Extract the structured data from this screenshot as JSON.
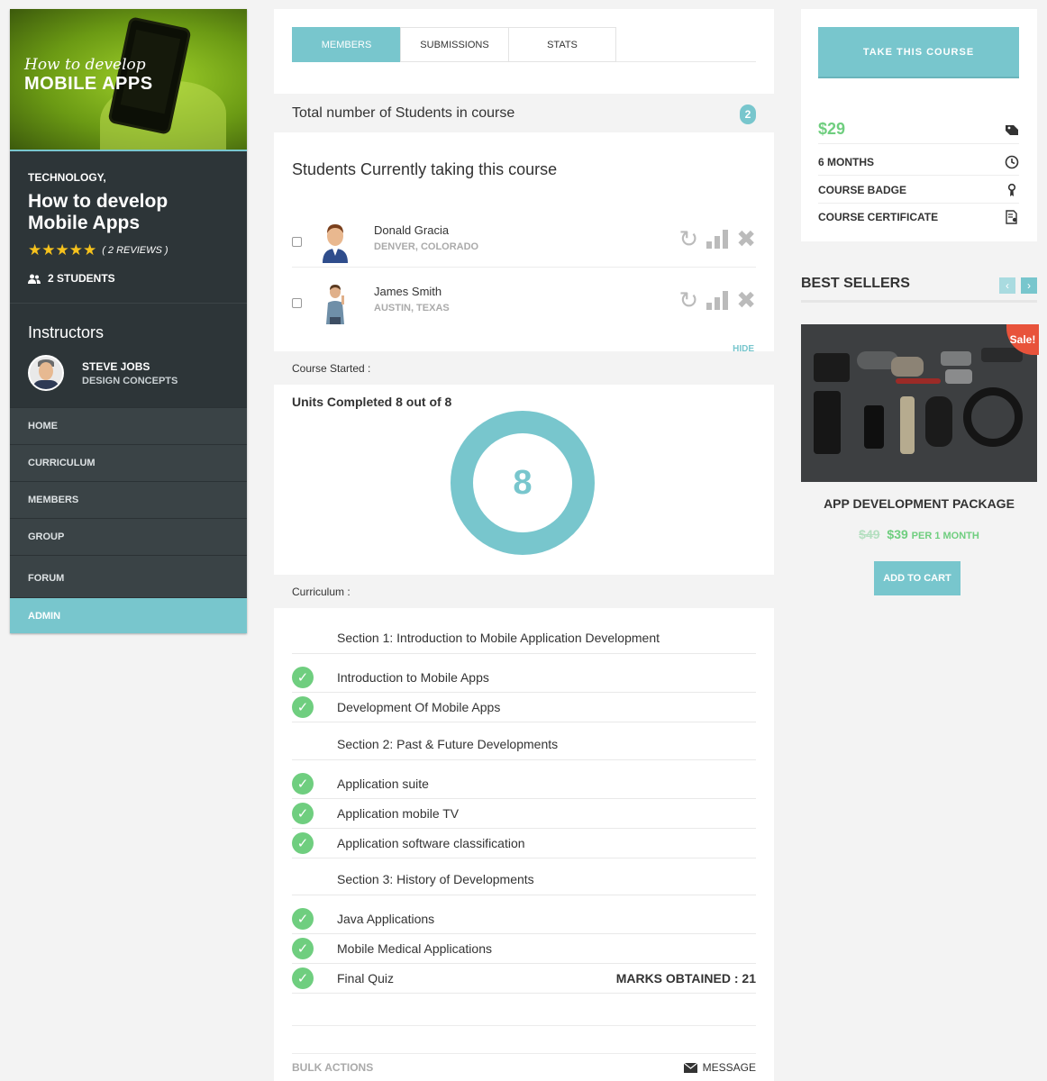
{
  "course": {
    "image_line1": "How to develop",
    "image_line2": "MOBILE APPS",
    "category": "TECHNOLOGY,",
    "title": "How to develop Mobile Apps",
    "stars": "★★★★★",
    "reviews": "( 2 REVIEWS )",
    "students": "2 STUDENTS"
  },
  "instructors": {
    "heading": "Instructors",
    "name": "STEVE JOBS",
    "role": "DESIGN CONCEPTS"
  },
  "nav": [
    "HOME",
    "CURRICULUM",
    "MEMBERS",
    "GROUP",
    "FORUM",
    "ADMIN"
  ],
  "tabs": [
    "MEMBERS",
    "SUBMISSIONS",
    "STATS"
  ],
  "members": {
    "total_label": "Total number of Students in course",
    "total_count": "2",
    "subheading": "Students Currently taking this course",
    "students": [
      {
        "name": "Donald Gracia",
        "location": "DENVER, COLORADO"
      },
      {
        "name": "James Smith",
        "location": "AUSTIN, TEXAS"
      }
    ],
    "hide_label": "HIDE"
  },
  "stats": {
    "course_started": "Course Started :",
    "units_completed": "Units Completed 8 out of 8",
    "units_value": "8",
    "progress_fraction": 1.0,
    "curriculum_label": "Curriculum :"
  },
  "curriculum": [
    {
      "type": "section",
      "label": "Section 1: Introduction to Mobile Application Development"
    },
    {
      "type": "unit",
      "label": "Introduction to Mobile Apps"
    },
    {
      "type": "unit",
      "label": "Development Of Mobile Apps"
    },
    {
      "type": "section",
      "label": "Section 2: Past & Future Developments"
    },
    {
      "type": "unit",
      "label": "Application suite"
    },
    {
      "type": "unit",
      "label": "Application mobile TV"
    },
    {
      "type": "unit",
      "label": "Application software classification"
    },
    {
      "type": "section",
      "label": "Section 3: History of Developments"
    },
    {
      "type": "unit",
      "label": "Java Applications"
    },
    {
      "type": "unit",
      "label": "Mobile Medical Applications"
    },
    {
      "type": "unit",
      "label": "Final Quiz",
      "marks": "MARKS OBTAINED : 21"
    }
  ],
  "footer": {
    "bulk_actions": "BULK ACTIONS",
    "message": "MESSAGE"
  },
  "pricing": {
    "take_course": "TAKE THIS COURSE",
    "price": "$29",
    "duration": "6 MONTHS",
    "badge": "COURSE BADGE",
    "certificate": "COURSE CERTIFICATE"
  },
  "best_sellers": {
    "title": "BEST SELLERS",
    "sale": "Sale!",
    "product_name": "APP DEVELOPMENT PACKAGE",
    "old_price": "$49",
    "new_price": "$39",
    "period": "PER 1 MONTH",
    "add_to_cart": "ADD TO CART"
  },
  "colors": {
    "accent": "#78c6cd",
    "green": "#6fce7f",
    "sidebar": "#2d3538",
    "sale": "#e8533b"
  }
}
